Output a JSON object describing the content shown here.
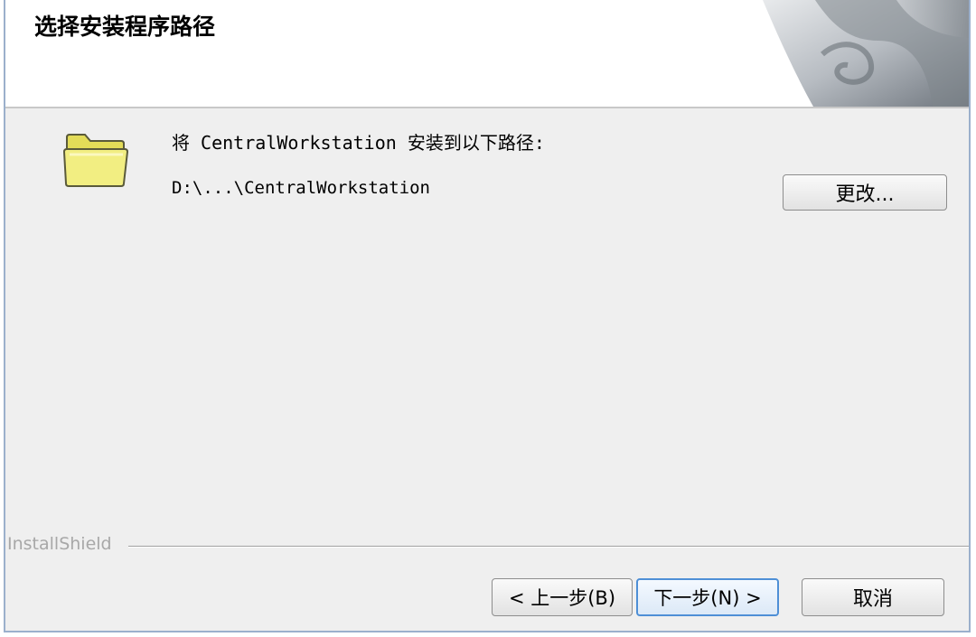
{
  "dialog": {
    "title": "选择安装程序路径",
    "install_label": "将 CentralWorkstation 安装到以下路径:",
    "install_path": "D:\\...\\CentralWorkstation",
    "change_button": "更改...",
    "brand": "InstallShield",
    "back_button": "< 上一步(B)",
    "next_button": "下一步(N) >",
    "cancel_button": "取消"
  },
  "colors": {
    "window_border": "#9bb0cc",
    "body_bg": "#efefef",
    "folder_yellow": "#f2ee82",
    "default_button_border": "#4e8fd6"
  }
}
